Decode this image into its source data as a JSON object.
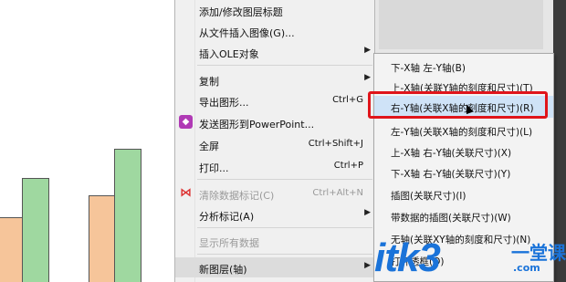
{
  "menu": {
    "items": [
      {
        "label": "添加/修改图层标题",
        "shortcut": "",
        "submenu": false,
        "disabled": false
      },
      {
        "label": "从文件插入图像(G)...",
        "shortcut": "",
        "submenu": false,
        "disabled": false
      },
      {
        "label": "插入OLE对象",
        "shortcut": "",
        "submenu": true,
        "disabled": false
      },
      {
        "label": "复制",
        "shortcut": "",
        "submenu": true,
        "disabled": false
      },
      {
        "label": "导出图形...",
        "shortcut": "Ctrl+G",
        "submenu": false,
        "disabled": false
      },
      {
        "label": "发送图形到PowerPoint...",
        "shortcut": "",
        "submenu": false,
        "disabled": false
      },
      {
        "label": "全屏",
        "shortcut": "Ctrl+Shift+J",
        "submenu": false,
        "disabled": false
      },
      {
        "label": "打印...",
        "shortcut": "Ctrl+P",
        "submenu": false,
        "disabled": false
      },
      {
        "label": "清除数据标记(C)",
        "shortcut": "Ctrl+Alt+N",
        "submenu": false,
        "disabled": true
      },
      {
        "label": "分析标记(A)",
        "shortcut": "",
        "submenu": true,
        "disabled": false
      },
      {
        "label": "显示所有数据",
        "shortcut": "",
        "submenu": false,
        "disabled": true
      },
      {
        "label": "新图层(轴)",
        "shortcut": "",
        "submenu": true,
        "disabled": false
      }
    ],
    "submenu_arrow": "▶"
  },
  "submenu": {
    "items": [
      {
        "label": "下-X轴 左-Y轴(B)"
      },
      {
        "label": "上-X轴(关联Y轴的刻度和尺寸)(T)"
      },
      {
        "label": "右-Y轴(关联X轴的刻度和尺寸)(R)"
      },
      {
        "label": "左-Y轴(关联X轴的刻度和尺寸)(L)"
      },
      {
        "label": "上-X轴 右-Y轴(关联尺寸)(X)"
      },
      {
        "label": "下-X轴 右-Y轴(关联尺寸)(Y)"
      },
      {
        "label": "插图(关联尺寸)(I)"
      },
      {
        "label": "带数据的插图(关联尺寸)(W)"
      },
      {
        "label": "无轴(关联XY轴的刻度和尺寸)(N)"
      },
      {
        "label": "打开透框(O)"
      }
    ]
  },
  "watermark": {
    "main": "itk3",
    "cn": "一堂课",
    "url": ".com"
  },
  "icons": {
    "ppt": "powerpoint-icon",
    "clear": "clear-marker-icon"
  },
  "colors": {
    "highlight_border": "#e0151b",
    "watermark": "#1a73d9",
    "bar_orange": "#f6c59a",
    "bar_green": "#9fd8a0"
  }
}
